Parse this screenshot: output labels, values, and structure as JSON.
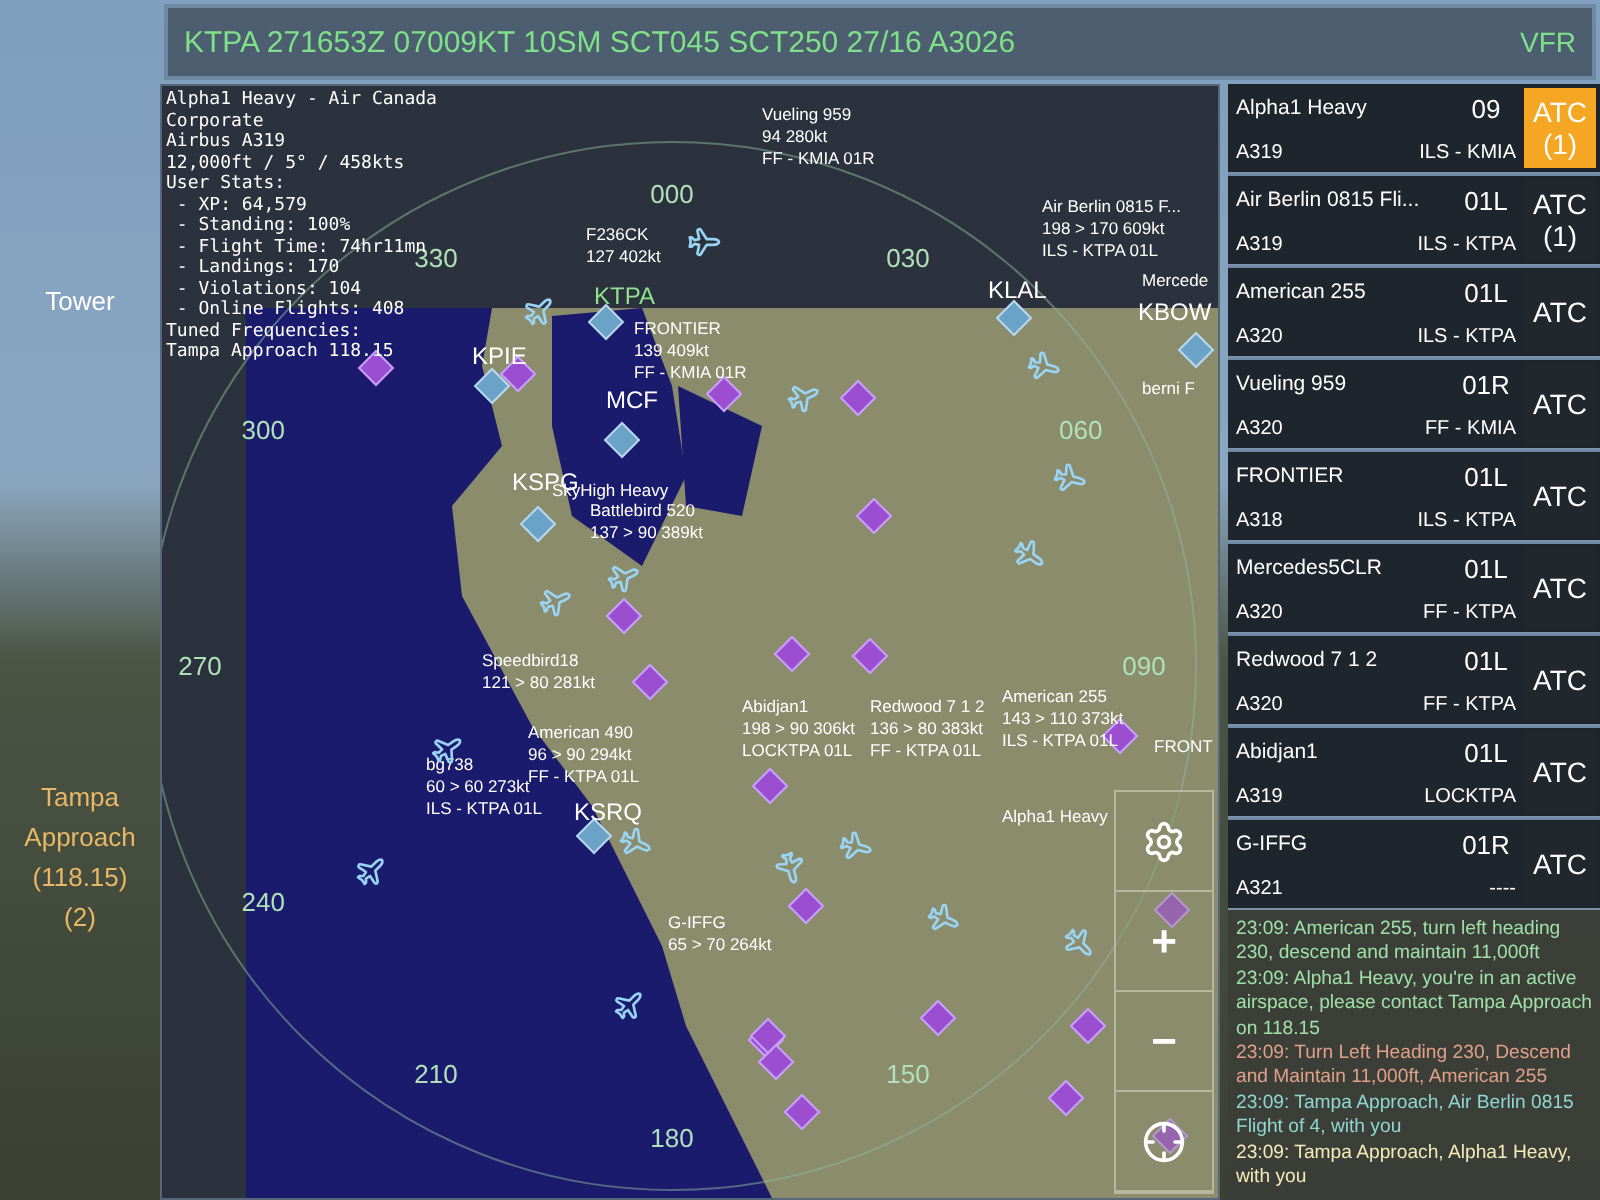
{
  "metar": {
    "text": "KTPA 271653Z 07009KT 10SM SCT045 SCT250 27/16 A3026",
    "flight_rules": "VFR"
  },
  "frequencies": [
    {
      "name": "Tower",
      "selected": false
    },
    {
      "name": "Tampa Approach",
      "frequency": "(118.15)",
      "count": "(2)",
      "selected": true
    }
  ],
  "info": [
    "Alpha1 Heavy - Air Canada",
    "Corporate",
    "Airbus A319",
    "12,000ft / 5° / 458kts",
    "User Stats:",
    " - XP: 64,579",
    " - Standing: 100%",
    " - Flight Time: 74hr11mn",
    " - Landings: 170",
    " - Violations: 104",
    " - Online Flights: 408",
    "Tuned Frequencies:",
    "Tampa Approach 118.15"
  ],
  "radar": {
    "compass": [
      "000",
      "030",
      "060",
      "090",
      "150",
      "180",
      "210",
      "240",
      "270",
      "300",
      "330"
    ],
    "airports": [
      {
        "code": "KTPA",
        "selected": true
      },
      {
        "code": "KPIE",
        "selected": false
      },
      {
        "code": "MCF",
        "selected": false
      },
      {
        "code": "KSPG",
        "selected": false
      },
      {
        "code": "KLAL",
        "selected": false
      },
      {
        "code": "KBOW",
        "selected": false
      },
      {
        "code": "KSRQ",
        "selected": false
      }
    ],
    "aircraft": [
      {
        "lines": [
          "Vueling 959",
          "94 280kt",
          "FF - KMIA 01R"
        ]
      },
      {
        "lines": [
          "F236CK",
          "127 402kt"
        ]
      },
      {
        "lines": [
          "FRONTIER",
          "139 409kt",
          "FF - KMIA 01R"
        ]
      },
      {
        "lines": [
          "Air Berlin 0815 F...",
          "198 > 170 609kt",
          "ILS - KTPA 01L"
        ]
      },
      {
        "lines": [
          "Mercede"
        ]
      },
      {
        "lines": [
          "berni F"
        ]
      },
      {
        "lines": [
          "SkyHigh Heavy"
        ]
      },
      {
        "lines": [
          "Battlebird 520",
          "137 > 90 389kt"
        ]
      },
      {
        "lines": [
          "Speedbird18",
          "121 > 80 281kt"
        ]
      },
      {
        "lines": [
          "American 490",
          "96 > 90 294kt",
          "FF - KTPA 01L"
        ]
      },
      {
        "lines": [
          "bg738",
          "60 > 60 273kt",
          "ILS - KTPA 01L"
        ]
      },
      {
        "lines": [
          "Abidjan1",
          "198 > 90 306kt",
          "LOCKTPA 01L"
        ]
      },
      {
        "lines": [
          "Redwood 7 1 2",
          "136 > 80 383kt",
          "FF - KTPA 01L"
        ]
      },
      {
        "lines": [
          "American 255",
          "143 > 110 373kt",
          "ILS - KTPA 01L"
        ]
      },
      {
        "lines": [
          "FRONT"
        ]
      },
      {
        "lines": [
          "Alpha1 Heavy"
        ]
      },
      {
        "lines": [
          "G-IFFG",
          "65 > 70 264kt"
        ]
      }
    ],
    "controls": [
      "+",
      "−"
    ]
  },
  "strips": [
    {
      "callsign": "Alpha1 Heavy",
      "runway": "09",
      "aircraft": "A319",
      "procedure": "ILS - KMIA",
      "atc": "ATC",
      "count": "(1)",
      "highlighted": true
    },
    {
      "callsign": "Air Berlin 0815 Fli...",
      "runway": "01L",
      "aircraft": "A319",
      "procedure": "ILS - KTPA",
      "atc": "ATC",
      "count": "(1)",
      "highlighted": false
    },
    {
      "callsign": "American 255",
      "runway": "01L",
      "aircraft": "A320",
      "procedure": "ILS - KTPA",
      "atc": "ATC",
      "highlighted": false
    },
    {
      "callsign": "Vueling 959",
      "runway": "01R",
      "aircraft": "A320",
      "procedure": "FF - KMIA",
      "atc": "ATC",
      "highlighted": false
    },
    {
      "callsign": "FRONTIER",
      "runway": "01L",
      "aircraft": "A318",
      "procedure": "ILS - KTPA",
      "atc": "ATC",
      "highlighted": false
    },
    {
      "callsign": "Mercedes5CLR",
      "runway": "01L",
      "aircraft": "A320",
      "procedure": "FF - KTPA",
      "atc": "ATC",
      "highlighted": false
    },
    {
      "callsign": "Redwood 7 1 2",
      "runway": "01L",
      "aircraft": "A320",
      "procedure": "FF - KTPA",
      "atc": "ATC",
      "highlighted": false
    },
    {
      "callsign": "Abidjan1",
      "runway": "01L",
      "aircraft": "A319",
      "procedure": "LOCKTPA",
      "atc": "ATC",
      "highlighted": false
    },
    {
      "callsign": "G-IFFG",
      "runway": "01R",
      "aircraft": "A321",
      "procedure": "----",
      "atc": "ATC",
      "highlighted": false
    }
  ],
  "messages": [
    {
      "text": "23:09: American 255, turn left heading 230, descend and maintain 11,000ft",
      "color": "#9fe0a8"
    },
    {
      "text": "23:09: Alpha1 Heavy, you're in an active airspace,  please contact Tampa Approach on 118.15",
      "color": "#9fe0a8"
    },
    {
      "text": "23:09: Turn Left Heading 230, Descend and Maintain 11,000ft, American 255",
      "color": "#e0a08a"
    },
    {
      "text": "23:09: Tampa Approach, Air Berlin 0815 Flight of 4, with you",
      "color": "#8fd8d0"
    },
    {
      "text": "23:09: Tampa Approach, Alpha1 Heavy, with you",
      "color": "#f4ecb8"
    }
  ]
}
